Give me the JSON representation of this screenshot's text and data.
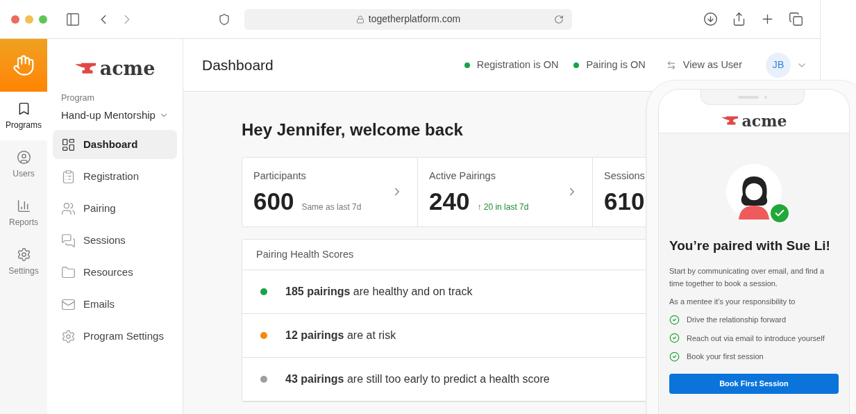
{
  "browser": {
    "url": "togetherplatform.com"
  },
  "rail": [
    {
      "label": "Programs",
      "selected": true
    },
    {
      "label": "Users",
      "selected": false
    },
    {
      "label": "Reports",
      "selected": false
    },
    {
      "label": "Settings",
      "selected": false
    }
  ],
  "sidebar": {
    "brand": "acme",
    "program_label": "Program",
    "program_name": "Hand-up Mentorship",
    "items": [
      {
        "label": "Dashboard",
        "selected": true
      },
      {
        "label": "Registration",
        "selected": false
      },
      {
        "label": "Pairing",
        "selected": false
      },
      {
        "label": "Sessions",
        "selected": false
      },
      {
        "label": "Resources",
        "selected": false
      },
      {
        "label": "Emails",
        "selected": false
      },
      {
        "label": "Program Settings",
        "selected": false
      }
    ]
  },
  "header": {
    "title": "Dashboard",
    "statuses": [
      {
        "label": "Registration is ON",
        "color": "#17a34a"
      },
      {
        "label": "Pairing is ON",
        "color": "#17a34a"
      }
    ],
    "view_as_user": "View as User",
    "avatar": "JB"
  },
  "greeting": "Hey Jennifer, welcome back",
  "stats": [
    {
      "label": "Participants",
      "value": "600",
      "note": "Same as last 7d",
      "kind": "neutral"
    },
    {
      "label": "Active Pairings",
      "value": "240",
      "note": "↑ 20 in last 7d",
      "kind": "positive"
    },
    {
      "label": "Sessions",
      "value": "610"
    }
  ],
  "health": {
    "title": "Pairing Health Scores",
    "rows": [
      {
        "text": "**185 pairings** are healthy and on track",
        "color": "#17a34a"
      },
      {
        "text": "**12 pairings** are at risk",
        "color": "#f58a07"
      },
      {
        "text": "**43 pairings** are still too early to predict a health score",
        "color": "#9e9e9e"
      }
    ]
  },
  "phone": {
    "brand": "acme",
    "title": "You’re paired with Sue Li!",
    "intro": "Start by communicating over email, and find a time together to book a session.",
    "lead": "As a mentee it’s your responsibility to",
    "checklist": [
      "Drive the relationship forward",
      "Reach out via email to introduce yourself",
      "Book your first session"
    ],
    "button": "Book First Session"
  }
}
